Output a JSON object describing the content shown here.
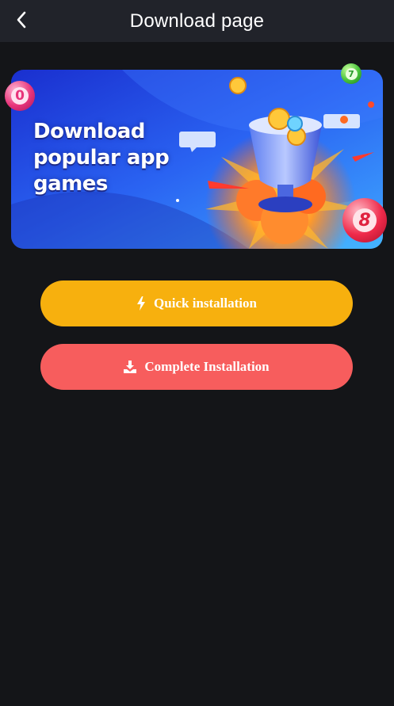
{
  "header": {
    "title": "Download page",
    "back_icon": "chevron-left-icon"
  },
  "banner": {
    "headline_line1": "Download",
    "headline_line2": "popular app",
    "headline_line3": "games",
    "balls": [
      "0",
      "7",
      "8"
    ],
    "colors": {
      "background_start": "#1e3bd6",
      "background_end": "#3aa0ff"
    }
  },
  "buttons": {
    "quick_label": "Quick installation",
    "quick_icon": "lightning-bolt-icon",
    "quick_color": "#f7b00e",
    "complete_label": "Complete Installation",
    "complete_icon": "download-tray-icon",
    "complete_color": "#f75d5d"
  }
}
